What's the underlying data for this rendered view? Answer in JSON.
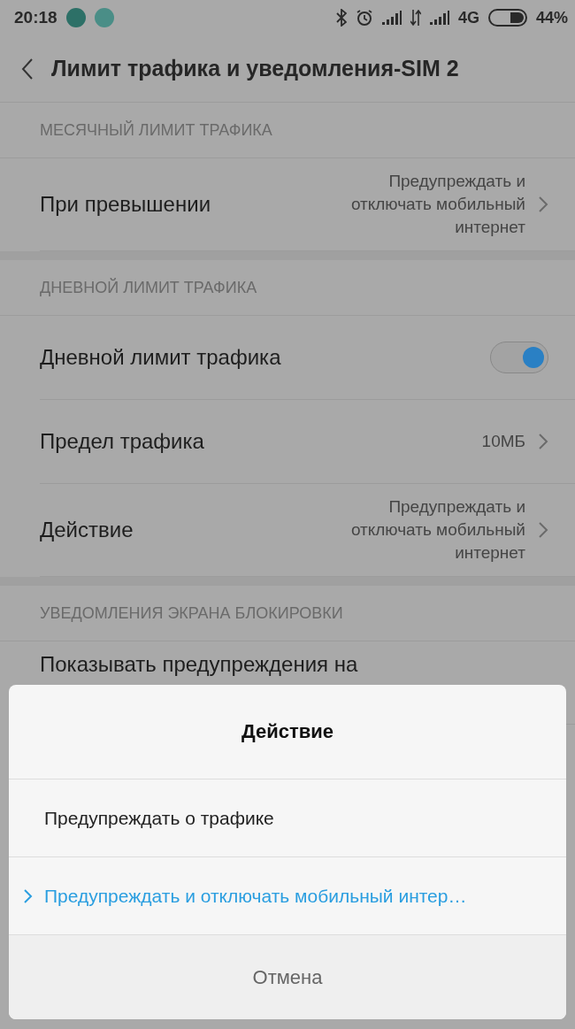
{
  "status_bar": {
    "time": "20:18",
    "network": "4G",
    "battery": "44%"
  },
  "header": {
    "title": "Лимит трафика и уведомления-SIM 2"
  },
  "sections": [
    {
      "header": "МЕСЯЧНЫЙ ЛИМИТ ТРАФИКА",
      "rows": [
        {
          "kind": "value",
          "label": "При превышении",
          "value": "Предупреждать и отключать мобильный интернет"
        }
      ]
    },
    {
      "header": "ДНЕВНОЙ ЛИМИТ ТРАФИКА",
      "rows": [
        {
          "kind": "toggle",
          "label": "Дневной лимит трафика",
          "on": true
        },
        {
          "kind": "value",
          "label": "Предел трафика",
          "value": "10МБ"
        },
        {
          "kind": "value",
          "label": "Действие",
          "value": "Предупреждать и отключать мобильный интернет"
        }
      ]
    },
    {
      "header": "УВЕДОМЛЕНИЯ ЭКРАНА БЛОКИРОВКИ",
      "rows": [
        {
          "kind": "text",
          "label": "Показывать предупреждения на"
        }
      ]
    }
  ],
  "dialog": {
    "title": "Действие",
    "options": [
      {
        "label": "Предупреждать о трафике",
        "selected": false
      },
      {
        "label": "Предупреждать и отключать мобильный интер…",
        "selected": true
      }
    ],
    "cancel": "Отмена"
  }
}
